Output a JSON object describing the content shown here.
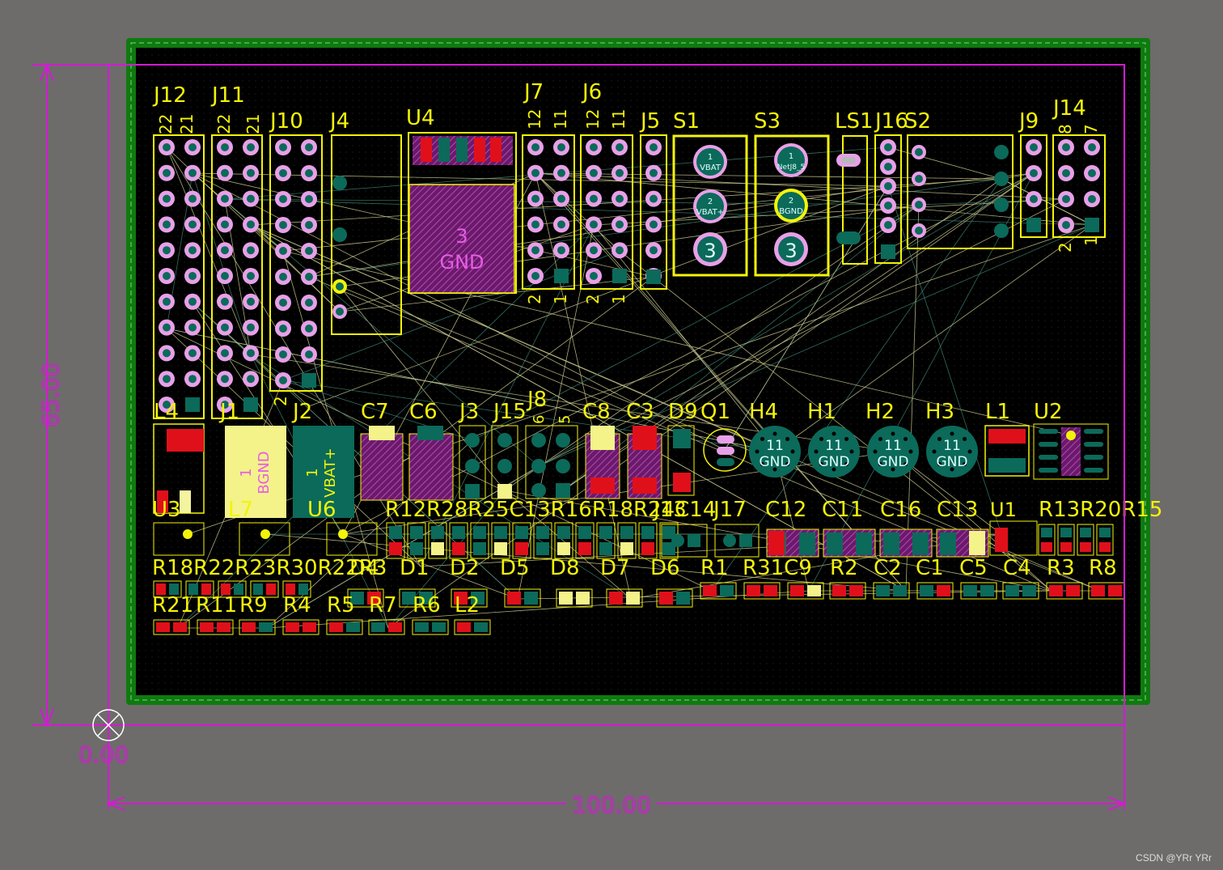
{
  "dimensions": {
    "width_label": "100.00",
    "height_label": "65.00",
    "origin_label": "0.00"
  },
  "watermark": "CSDN @YRr YRr",
  "colors": {
    "background": "#6e6b6b",
    "board_outline": "#0f7a0f",
    "board_fill": "#000000",
    "silkscreen": "#f3f30a",
    "dimension": "#d41ad4",
    "pad_copper": "#0b6a5a",
    "pad_red": "#e0101a",
    "ratsnest": "#c9c98e"
  },
  "headers": [
    {
      "ref": "J12",
      "pin_top_left": "22",
      "pin_top_right": "21"
    },
    {
      "ref": "J11",
      "pin_top_left": "22",
      "pin_top_right": "21"
    },
    {
      "ref": "J10",
      "pin_bottom_left": "2"
    },
    {
      "ref": "J7",
      "pin_top_left": "12",
      "pin_top_right": "11",
      "pin_bottom_left": "2",
      "pin_bottom_right": "1"
    },
    {
      "ref": "J6",
      "pin_top_left": "12",
      "pin_top_right": "11",
      "pin_bottom_left": "2",
      "pin_bottom_right": "1"
    },
    {
      "ref": "J14",
      "pin_top_left": "8",
      "pin_top_right": "7",
      "pin_bottom_left": "2",
      "pin_bottom_right": "1"
    },
    {
      "ref": "J8",
      "pin_top_left": "6",
      "pin_top_right": "5"
    }
  ],
  "parts_row1": [
    "J4",
    "U4",
    "J5",
    "S1",
    "S3",
    "LS1",
    "J16",
    "S2",
    "J9"
  ],
  "u4_pad_labels": [
    "3",
    "GND"
  ],
  "s1_pads": [
    "1",
    "VBAT",
    "2",
    "VBAT+",
    "3"
  ],
  "s3_pads": [
    "1",
    "NetJ8_5",
    "2",
    "BGND",
    "3"
  ],
  "parts_row2": [
    "L4",
    "J1",
    "J2",
    "C7",
    "C6",
    "J3",
    "J15",
    "C8",
    "C3",
    "D9",
    "Q1",
    "L1",
    "U2"
  ],
  "j1_pad_labels": [
    "1",
    "BGND"
  ],
  "j2_pad_labels": [
    "1",
    "VBAT+"
  ],
  "mount_holes": [
    {
      "ref": "H4",
      "pin": "11",
      "net": "GND"
    },
    {
      "ref": "H1",
      "pin": "11",
      "net": "GND"
    },
    {
      "ref": "H2",
      "pin": "11",
      "net": "GND"
    },
    {
      "ref": "H3",
      "pin": "11",
      "net": "GND"
    }
  ],
  "row3_labels": [
    "U3",
    "L7",
    "U6",
    "R12R28R25C13R16R18R24C14",
    "J13",
    "J17",
    "C12",
    "C11",
    "C16",
    "C13",
    "U1",
    "R13R20R15"
  ],
  "row4_labels": [
    "R18R22R23R30R22R3",
    "D4",
    "D1",
    "D2",
    "D5",
    "D8",
    "D7",
    "D6",
    "R1",
    "R31C9",
    "R2",
    "C2",
    "C1",
    "C5",
    "C4",
    "R3",
    "R8"
  ],
  "row5_labels": [
    "R21",
    "R11",
    "R9",
    "R4",
    "R5",
    "R7",
    "R6",
    "L2"
  ]
}
